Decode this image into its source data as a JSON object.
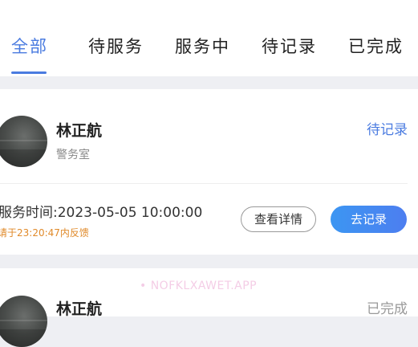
{
  "tabs": [
    {
      "label": "全部",
      "active": true
    },
    {
      "label": "待服务",
      "active": false
    },
    {
      "label": "服务中",
      "active": false
    },
    {
      "label": "待记录",
      "active": false
    },
    {
      "label": "已完成",
      "active": false
    }
  ],
  "cards": [
    {
      "name": "林正航",
      "department": "警务室",
      "status": "待记录",
      "service_time": "服务时间:2023-05-05 10:00:00",
      "deadline": "请于23:20:47内反馈",
      "detail_button": "查看详情",
      "record_button": "去记录"
    },
    {
      "name": "林正航",
      "status": "已完成"
    }
  ],
  "watermark": "• NOFKLXAWET.APP",
  "colors": {
    "accent": "#4a7be0",
    "deadline": "#e08a2a",
    "page_bg": "#eeeff3"
  }
}
